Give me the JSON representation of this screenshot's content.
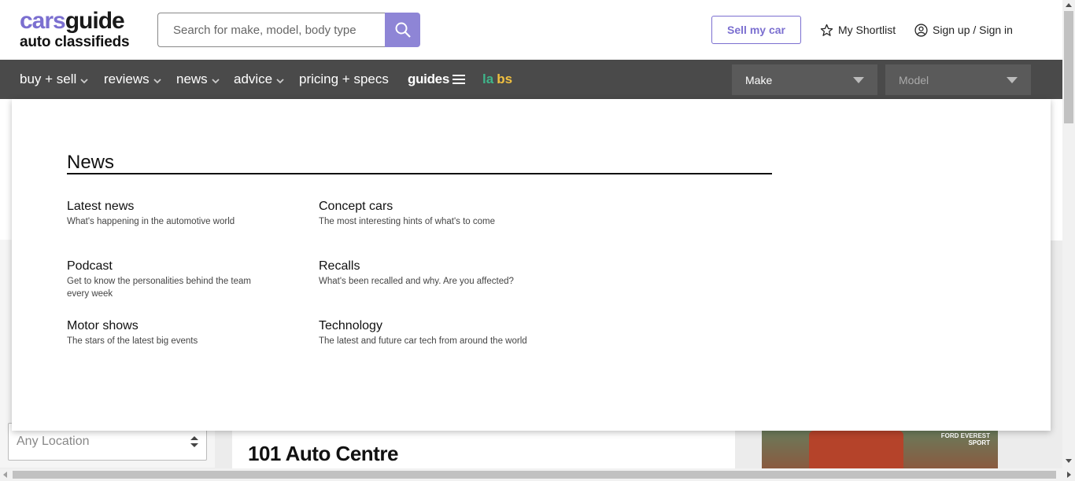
{
  "header": {
    "logo_top_a": "cars",
    "logo_top_b": "guide",
    "logo_bottom": "auto classifieds",
    "search_placeholder": "Search for make, model, body type",
    "sell_label": "Sell my car",
    "shortlist_label": "My Shortlist",
    "signin_label": "Sign up / Sign in"
  },
  "nav": {
    "items": [
      {
        "label": "buy + sell"
      },
      {
        "label": "reviews"
      },
      {
        "label": "news"
      },
      {
        "label": "advice"
      },
      {
        "label": "pricing + specs"
      },
      {
        "label": "guides"
      },
      {
        "label_a": "la",
        "label_b": "bs"
      }
    ],
    "make_label": "Make",
    "model_label": "Model"
  },
  "mega_menu": {
    "title": "News",
    "links": [
      {
        "title": "Latest news",
        "desc": "What's happening in the automotive world"
      },
      {
        "title": "Concept cars",
        "desc": "The most interesting hints of what's to come"
      },
      {
        "title": "Podcast",
        "desc": "Get to know the personalities behind the team every week"
      },
      {
        "title": "Recalls",
        "desc": "What's been recalled and why. Are you affected?"
      },
      {
        "title": "Motor shows",
        "desc": "The stars of the latest big events"
      },
      {
        "title": "Technology",
        "desc": "The latest and future car tech from around the world"
      }
    ]
  },
  "background": {
    "location_placeholder": "Any Location",
    "listing_title": "101 Auto Centre",
    "ad_text": "FORD EVEREST SPORT"
  },
  "colors": {
    "brand_purple": "#7b6fd0",
    "nav_bg": "#4a4a4a",
    "labs_green": "#3fb58a",
    "labs_yellow": "#f0c040"
  }
}
